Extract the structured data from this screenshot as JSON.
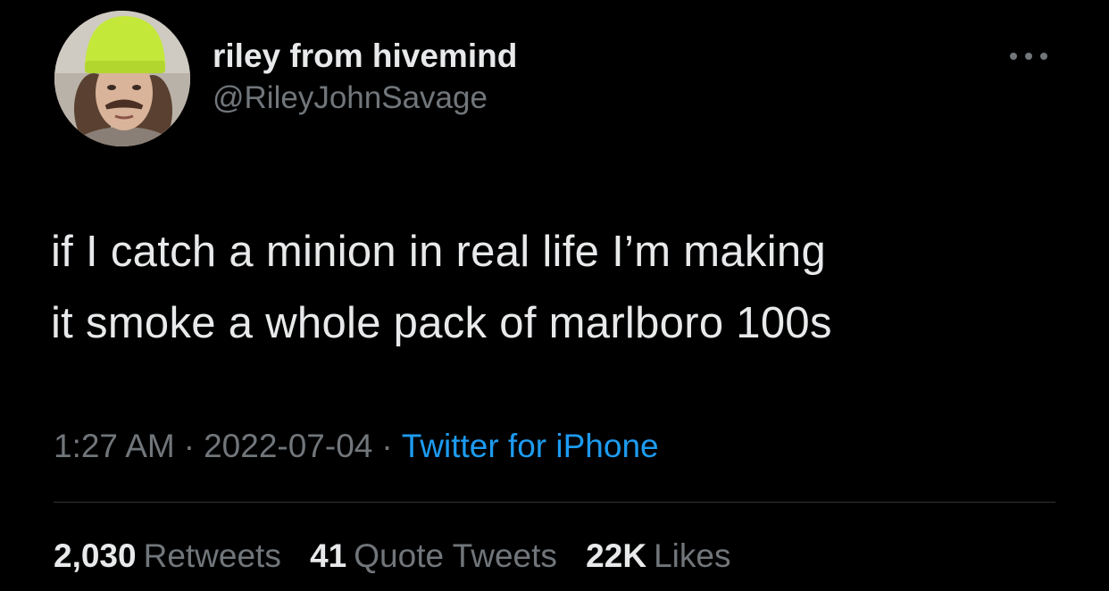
{
  "author": {
    "display_name": "riley from hivemind",
    "handle": "@RileyJohnSavage",
    "avatar_icon": "profile-photo"
  },
  "menu": {
    "icon": "more-options-icon"
  },
  "tweet": {
    "text_line_1": "if I catch a minion in real life I’m making",
    "text_line_2": "it smoke a whole pack of marlboro 100s"
  },
  "meta": {
    "time": "1:27 AM",
    "separator": "·",
    "date": "2022-07-04",
    "source": "Twitter for iPhone"
  },
  "stats": {
    "retweets": {
      "count": "2,030",
      "label": "Retweets"
    },
    "quotes": {
      "count": "41",
      "label": "Quote Tweets"
    },
    "likes": {
      "count": "22K",
      "label": "Likes"
    }
  },
  "colors": {
    "background": "#000000",
    "primary_text": "#e7e9ea",
    "secondary_text": "#71767b",
    "link": "#1d9bf0",
    "divider": "#2f3336"
  }
}
